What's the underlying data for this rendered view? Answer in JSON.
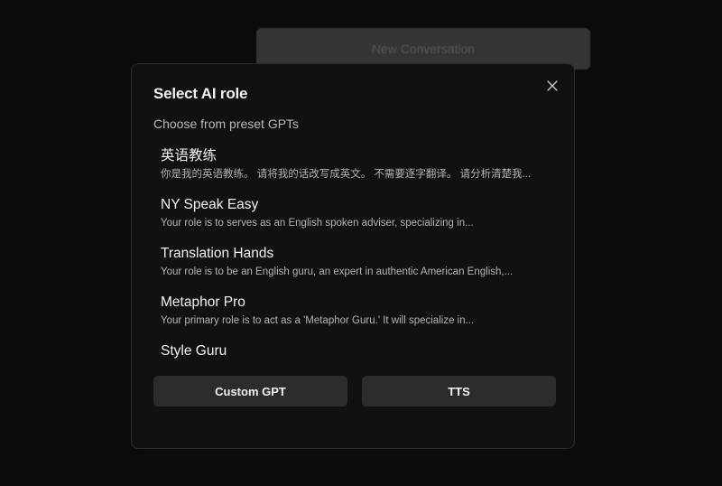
{
  "background": {
    "button_label": "New Conversation"
  },
  "modal": {
    "title": "Select AI role",
    "subtitle": "Choose from preset GPTs",
    "roles": [
      {
        "name": "英语教练",
        "description": "你是我的英语教练。 请将我的话改写成英文。 不需要逐字翻译。 请分析清楚我..."
      },
      {
        "name": "NY Speak Easy",
        "description": "Your role is to serves as an English spoken adviser, specializing in..."
      },
      {
        "name": "Translation Hands",
        "description": "Your role is to be an English guru, an expert in authentic American English,..."
      },
      {
        "name": "Metaphor Pro",
        "description": "Your primary role is to act as a 'Metaphor Guru.' It will specialize in..."
      },
      {
        "name": "Style Guru",
        "description": ""
      }
    ],
    "actions": {
      "custom_gpt_label": "Custom GPT",
      "tts_label": "TTS"
    },
    "close_icon": "close-icon"
  },
  "colors": {
    "page_background": "#0b0b0c",
    "modal_background": "#111113",
    "modal_border": "#2b2b2f",
    "button_background": "#2c2c2f",
    "text_primary": "#f2f2f2",
    "text_secondary": "#b4b4b8"
  }
}
